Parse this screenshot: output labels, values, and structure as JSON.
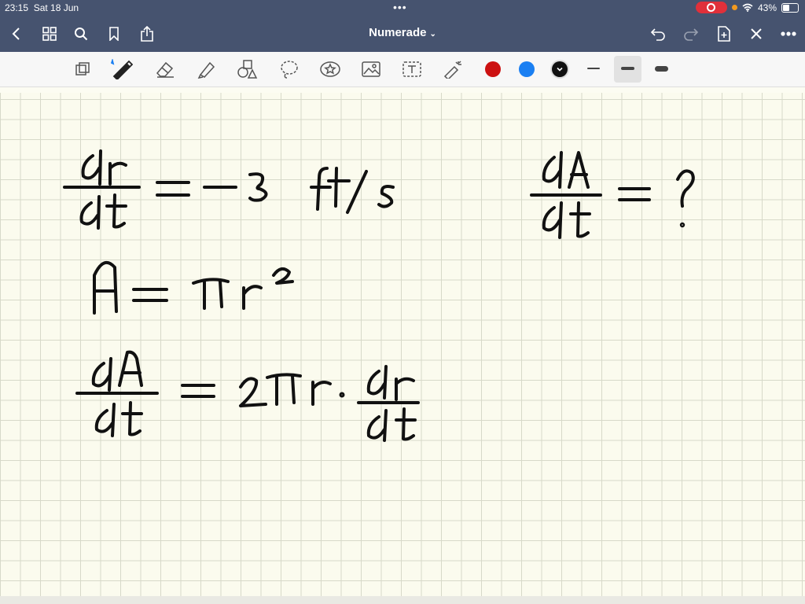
{
  "status_bar": {
    "time": "23:15",
    "date": "Sat 18 Jun",
    "battery": "43%"
  },
  "nav": {
    "title": "Numerade",
    "icons": [
      "back-icon",
      "grid-icon",
      "search-icon",
      "bookmark-icon",
      "share-icon",
      "undo-icon",
      "redo-icon",
      "add-page-icon",
      "close-icon",
      "more-icon"
    ]
  },
  "toolbar": {
    "tools": [
      "page-icon",
      "pen-icon",
      "eraser-icon",
      "highlighter-icon",
      "shapes-icon",
      "lasso-icon",
      "sticker-icon",
      "image-icon",
      "text-icon",
      "laser-icon"
    ],
    "colors": [
      "#cc1111",
      "#1a7ff2",
      "#111111"
    ],
    "selected_color": "#111111",
    "stroke_widths": [
      "thin",
      "medium",
      "thick"
    ],
    "selected_stroke": "medium"
  },
  "handwriting": {
    "line1": "dr/dt = -3 ft/s",
    "line1_right": "dA/dt = ?",
    "line2": "A = πr²",
    "line3": "dA/dt = 2πr · dr/dt"
  }
}
